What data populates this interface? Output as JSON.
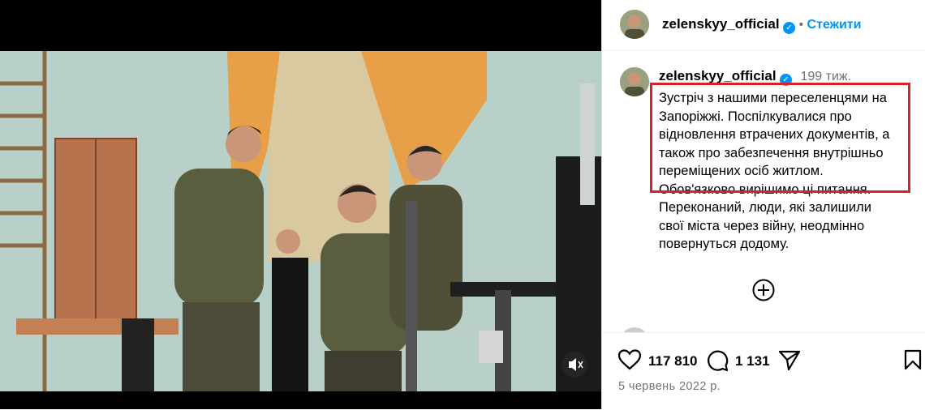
{
  "post": {
    "author": "zelenskyy_official",
    "follow_label": "Стежити",
    "verified_badge": "verified-badge-icon",
    "time_ago": "199 тиж.",
    "caption_lines": [
      "Зустріч з нашими переселенцями на",
      "Запоріжжі. Поспілкувалися про",
      "відновлення втрачених документів, а",
      "також про забезпечення внутрішньо",
      "переміщених осіб житлом.",
      "Обов'язково вирішимо ці питання.",
      "Переконаний, люди, які залишили",
      "свої міста через війну, неодмінно",
      "повернуться додому."
    ],
    "likes": "117 810",
    "comments": "1 131",
    "date": "5 червень 2022 р."
  },
  "colors": {
    "accent": "#0095f6",
    "highlight_border": "#d7222a",
    "muted": "#737373"
  },
  "icons": {
    "like": "heart-icon",
    "comment": "comment-icon",
    "share": "send-icon",
    "save": "bookmark-icon",
    "more_comments": "plus-circle-icon",
    "mute": "speaker-icon"
  }
}
